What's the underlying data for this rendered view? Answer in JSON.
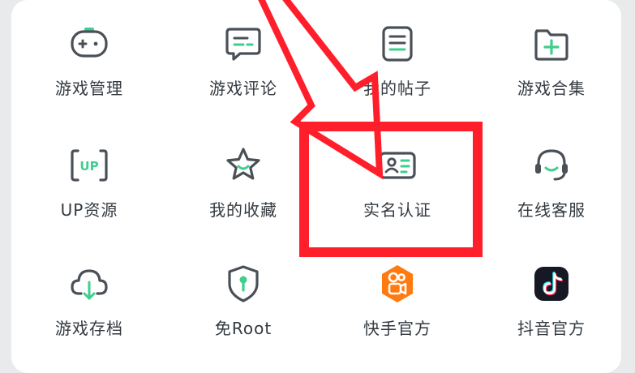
{
  "menu": {
    "items": [
      {
        "label": "游戏管理",
        "icon": "gamepad-icon"
      },
      {
        "label": "游戏评论",
        "icon": "comment-icon"
      },
      {
        "label": "我的帖子",
        "icon": "post-list-icon"
      },
      {
        "label": "游戏合集",
        "icon": "folder-add-icon"
      },
      {
        "label": "UP资源",
        "icon": "up-badge-icon"
      },
      {
        "label": "我的收藏",
        "icon": "star-icon"
      },
      {
        "label": "实名认证",
        "icon": "id-card-icon"
      },
      {
        "label": "在线客服",
        "icon": "headset-icon"
      },
      {
        "label": "游戏存档",
        "icon": "cloud-download-icon"
      },
      {
        "label": "免Root",
        "icon": "shield-key-icon"
      },
      {
        "label": "快手官方",
        "icon": "kuaishou-logo-icon"
      },
      {
        "label": "抖音官方",
        "icon": "douyin-logo-icon"
      }
    ]
  },
  "colors": {
    "icon_stroke": "#4a5057",
    "icon_accent": "#3fce8e",
    "annotation_red": "#ff1f2a",
    "kuaishou_orange": "#ff7a10",
    "douyin_dark": "#161823"
  }
}
